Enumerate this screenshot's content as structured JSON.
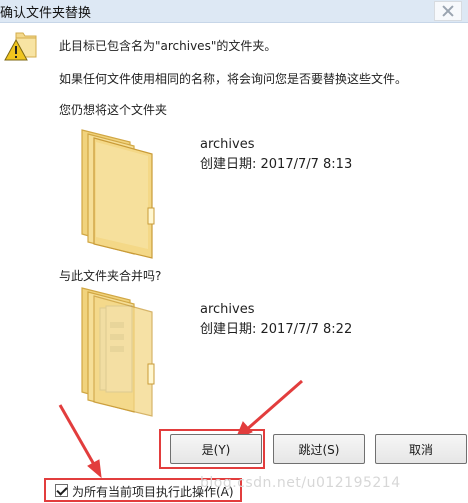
{
  "window": {
    "title": "确认文件夹替换"
  },
  "message": {
    "line1": "此目标已包含名为\"archives\"的文件夹。",
    "line2": "如果任何文件使用相同的名称，将会询问您是否要替换这些文件。",
    "line3": "您仍想将这个文件夹"
  },
  "existing_folder": {
    "name": "archives",
    "date": "创建日期: 2017/7/7 8:13"
  },
  "merge_prompt": "与此文件夹合并吗?",
  "incoming_folder": {
    "name": "archives",
    "date": "创建日期: 2017/7/7 8:22"
  },
  "buttons": {
    "yes": "是(Y)",
    "skip": "跳过(S)",
    "cancel": "取消"
  },
  "checkbox": {
    "label": "为所有当前项目执行此操作(A)",
    "checked": true
  },
  "watermark": "blog.csdn.net/u012195214",
  "colors": {
    "annotation_red": "#e23d3d",
    "folder_yellow": "#f2d57a"
  }
}
